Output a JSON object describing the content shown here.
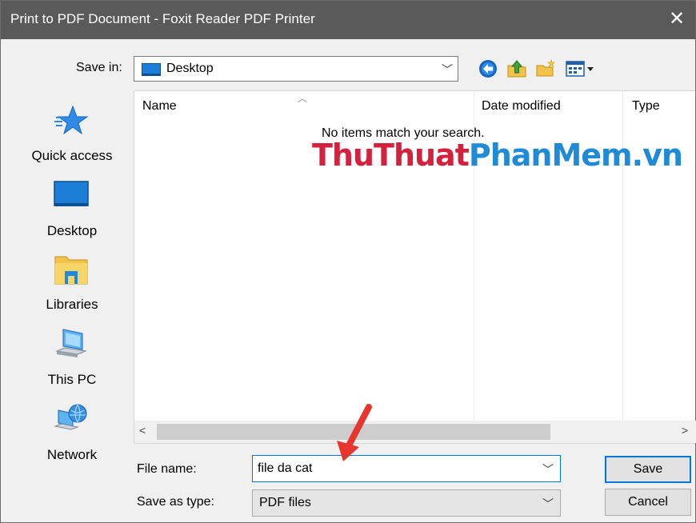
{
  "window": {
    "title": "Print to PDF Document - Foxit Reader PDF Printer",
    "close_glyph": "✕"
  },
  "toolbar": {
    "save_in_label": "Save in:",
    "save_in_value": "Desktop",
    "icons": [
      "back-arrow-icon",
      "up-folder-icon",
      "new-folder-icon",
      "views-menu-icon"
    ]
  },
  "places": [
    {
      "label": "Quick access",
      "icon": "star-icon"
    },
    {
      "label": "Desktop",
      "icon": "desktop-icon"
    },
    {
      "label": "Libraries",
      "icon": "libraries-icon"
    },
    {
      "label": "This PC",
      "icon": "computer-icon"
    },
    {
      "label": "Network",
      "icon": "network-icon"
    }
  ],
  "file_list": {
    "columns": [
      "Name",
      "Date modified",
      "Type"
    ],
    "empty_message": "No items match your search."
  },
  "watermark": {
    "part1": "ThuThuat",
    "part2": "PhanMem.vn"
  },
  "form": {
    "file_name_label": "File name:",
    "file_name_value": "file da cat",
    "save_as_type_label": "Save as type:",
    "save_as_type_value": "PDF files"
  },
  "buttons": {
    "save": "Save",
    "cancel": "Cancel"
  },
  "colors": {
    "titlebar": "#5a5a5a",
    "accent": "#0078d7",
    "annotation_arrow": "#e8362f",
    "watermark_red": "#d4213d",
    "watermark_blue": "#1f8ad6"
  }
}
